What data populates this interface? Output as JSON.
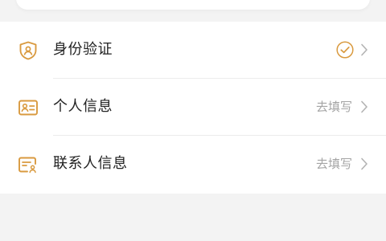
{
  "colors": {
    "accent": "#d99a3f",
    "muted": "#a4a4a4",
    "text": "#222222",
    "background": "#f3f3f3"
  },
  "items": [
    {
      "label": "身份验证",
      "status": "",
      "icon": "id-shield-icon",
      "status_icon": "check-circle-icon"
    },
    {
      "label": "个人信息",
      "status": "去填写",
      "icon": "id-card-icon"
    },
    {
      "label": "联系人信息",
      "status": "去填写",
      "icon": "contact-form-icon"
    }
  ]
}
